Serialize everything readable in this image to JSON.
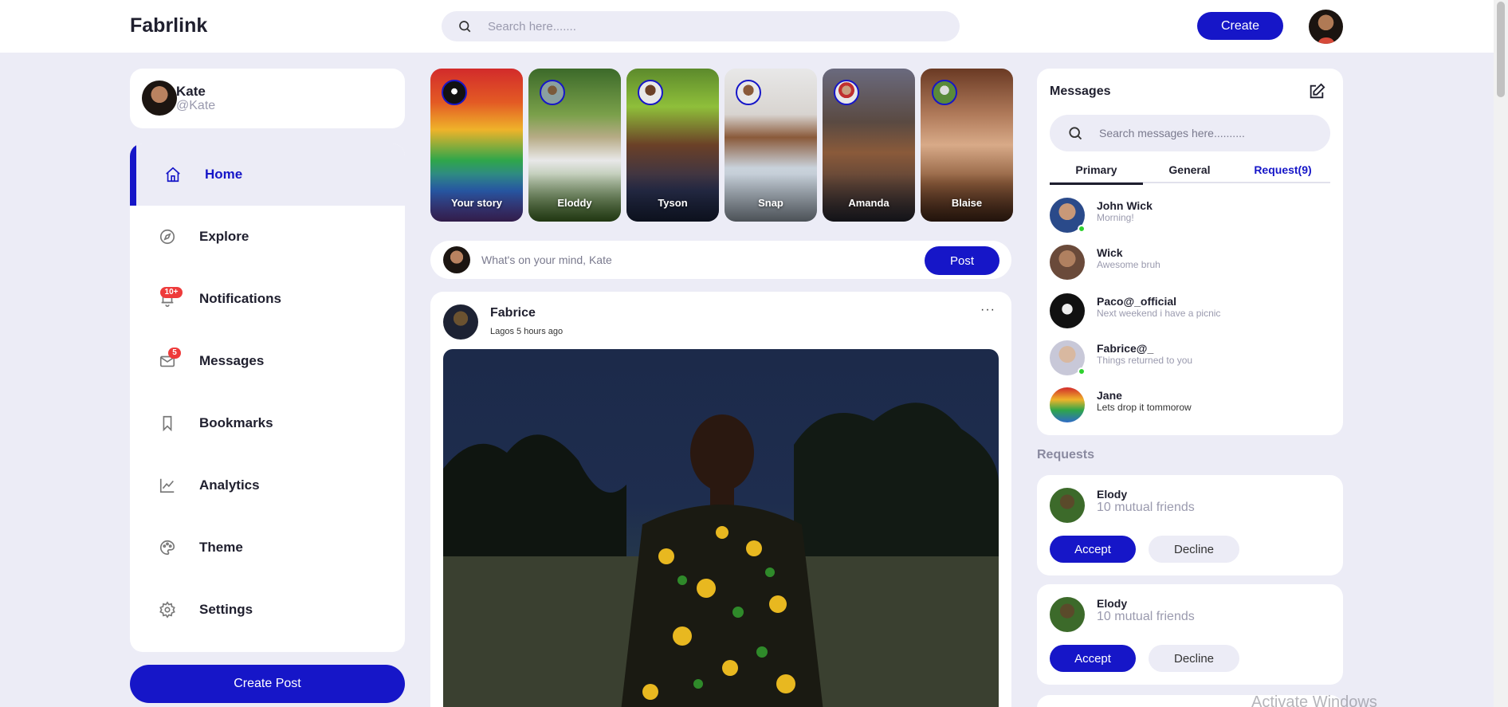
{
  "app": {
    "logo": "Fabrlink"
  },
  "topnav": {
    "search_placeholder": "Search here.......",
    "create_label": "Create"
  },
  "profile": {
    "name": "Kate",
    "handle": "@Kate"
  },
  "menu": {
    "items": [
      {
        "label": "Home",
        "icon": "home-icon",
        "active": true
      },
      {
        "label": "Explore",
        "icon": "compass-icon"
      },
      {
        "label": "Notifications",
        "icon": "bell-icon",
        "badge": "10+"
      },
      {
        "label": "Messages",
        "icon": "envelope-icon",
        "badge": "5"
      },
      {
        "label": "Bookmarks",
        "icon": "bookmark-icon"
      },
      {
        "label": "Analytics",
        "icon": "chart-line-icon"
      },
      {
        "label": "Theme",
        "icon": "palette-icon"
      },
      {
        "label": "Settings",
        "icon": "gear-icon"
      }
    ],
    "create_post_label": "Create Post"
  },
  "stories": [
    {
      "label": "Your story"
    },
    {
      "label": "Eloddy"
    },
    {
      "label": "Tyson"
    },
    {
      "label": "Snap"
    },
    {
      "label": "Amanda"
    },
    {
      "label": "Blaise"
    }
  ],
  "composer": {
    "placeholder": "What's on your mind, Kate",
    "post_label": "Post"
  },
  "feed": {
    "post": {
      "author": "Fabrice",
      "meta": "Lagos 5 hours ago",
      "more": "···"
    }
  },
  "messages": {
    "title": "Messages",
    "search_placeholder": "Search messages here..........",
    "tabs": [
      {
        "label": "Primary",
        "active": true
      },
      {
        "label": "General"
      },
      {
        "label": "Request(9)",
        "accent": true
      }
    ],
    "items": [
      {
        "name": "John Wick",
        "text": "Morning!",
        "online": true
      },
      {
        "name": "Wick",
        "text": "Awesome bruh"
      },
      {
        "name": "Paco@_official",
        "text": "Next weekend i have a picnic"
      },
      {
        "name": "Fabrice@_",
        "text": "Things returned to you",
        "online": true
      },
      {
        "name": "Jane",
        "text": "Lets drop it tommorow"
      }
    ]
  },
  "requests": {
    "heading": "Requests",
    "items": [
      {
        "name": "Elody",
        "mutual": "10 mutual friends",
        "accept": "Accept",
        "decline": "Decline"
      },
      {
        "name": "Elody",
        "mutual": "10 mutual friends",
        "accept": "Accept",
        "decline": "Decline"
      }
    ]
  },
  "watermark": "Activate Windows",
  "colors": {
    "accent": "#1616c8",
    "background": "#ececf6",
    "badge": "#ee3b3b",
    "online": "#2ed12e"
  }
}
